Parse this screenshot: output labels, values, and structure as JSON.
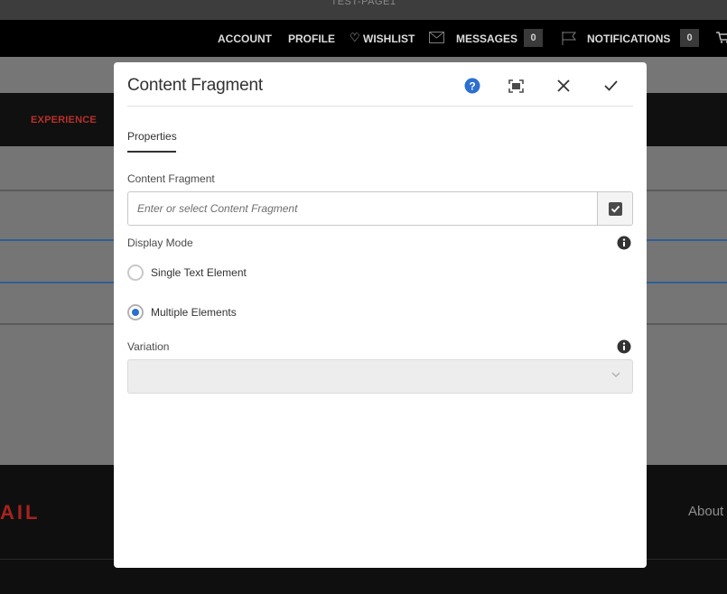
{
  "background": {
    "page_title": "TEST-PAGE1",
    "nav": {
      "account": "ACCOUNT",
      "profile": "PROFILE",
      "wishlist": "WISHLIST",
      "messages": "MESSAGES",
      "messages_count": "0",
      "notifications": "NOTIFICATIONS",
      "notifications_count": "0"
    },
    "menu_item": "EXPERIENCE",
    "footer_brand": "AIL",
    "footer_link": "About"
  },
  "dialog": {
    "title": "Content Fragment",
    "icons": [
      "help-icon",
      "fullscreen-icon",
      "close-icon",
      "confirm-icon"
    ],
    "tabs": [
      {
        "label": "Properties",
        "active": true
      }
    ],
    "content_fragment": {
      "label": "Content Fragment",
      "value": "",
      "placeholder": "Enter or select Content Fragment"
    },
    "display_mode": {
      "label": "Display Mode",
      "options": [
        {
          "label": "Single Text Element",
          "checked": false
        },
        {
          "label": "Multiple Elements",
          "checked": true
        }
      ]
    },
    "variation": {
      "label": "Variation",
      "selected": ""
    }
  },
  "colors": {
    "accent_blue": "#2d6fcf",
    "brand_red": "#b8302a",
    "overlay_grey": "#757575"
  }
}
